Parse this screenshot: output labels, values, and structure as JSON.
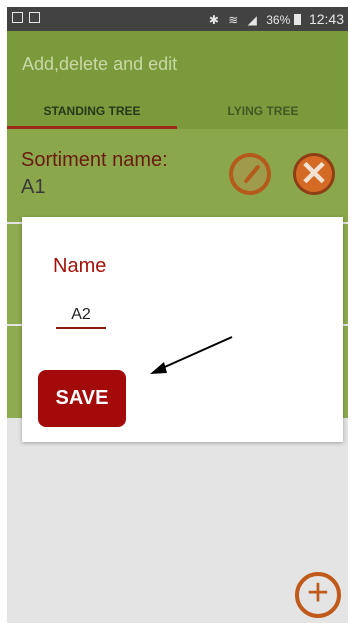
{
  "status_bar": {
    "battery": "36%",
    "time": "12:43",
    "icons": [
      "image-icon",
      "file-icon",
      "bluetooth-icon",
      "wifi-icon",
      "signal-icon",
      "battery-icon"
    ]
  },
  "app_bar": {
    "title": "Add,delete and edit",
    "tabs": [
      {
        "label": "STANDING TREE",
        "selected": true
      },
      {
        "label": "LYING TREE",
        "selected": false
      }
    ]
  },
  "list": {
    "items": [
      {
        "label": "Sortiment name:",
        "value": "A1"
      }
    ]
  },
  "dialog": {
    "title": "Name",
    "input_value": "A2",
    "save_label": "SAVE"
  },
  "colors": {
    "app_bar": "#7b9a3c",
    "accent_red": "#a30a0a",
    "accent_orange": "#c05a1b"
  }
}
